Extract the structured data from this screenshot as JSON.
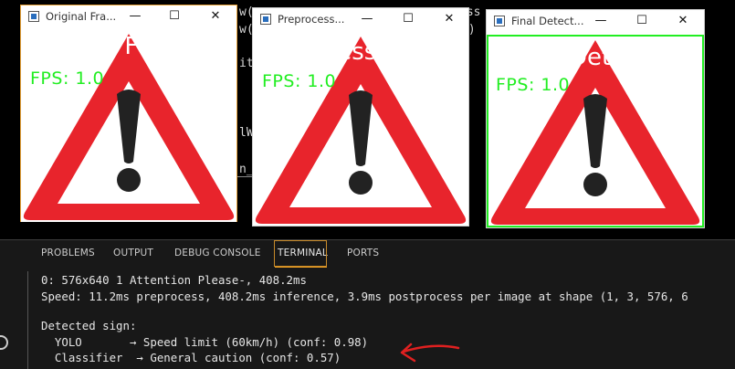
{
  "editor": {
    "frag1": "w(",
    "frag2": "ess",
    "frag3": "w(",
    "frag4": "e)",
    "frag5": "it",
    "frag6": "lW",
    "frag7": "n_"
  },
  "windows": [
    {
      "title": "Original Fra...",
      "overlay": "al F",
      "fps": "FPS: 1.0"
    },
    {
      "title": "Preprocess...",
      "overlay": "ocess",
      "fps": "FPS: 1.0"
    },
    {
      "title": "Final Detect...",
      "overlay": "Dete",
      "fps": "FPS: 1.0"
    }
  ],
  "controls": {
    "minimize": "—",
    "maximize": "☐",
    "close": "✕"
  },
  "panel": {
    "tabs": [
      "PROBLEMS",
      "OUTPUT",
      "DEBUG CONSOLE",
      "TERMINAL",
      "PORTS"
    ],
    "active_tab": "TERMINAL"
  },
  "terminal": {
    "line1": "0: 576x640 1 Attention Please-, 408.2ms",
    "line2": "Speed: 11.2ms preprocess, 408.2ms inference, 3.9ms postprocess per image at shape (1, 3, 576, 6",
    "line3": "Detected sign:",
    "line4": "  YOLO       → Speed limit (60km/h) (conf: 0.98)",
    "line5": "  Classifier  → General caution (conf: 0.57)"
  },
  "colors": {
    "triangle_red": "#e8242c",
    "fps_green": "#22ee22",
    "annotation_red": "#e02020",
    "active_tab_underline": "#f0a020"
  }
}
